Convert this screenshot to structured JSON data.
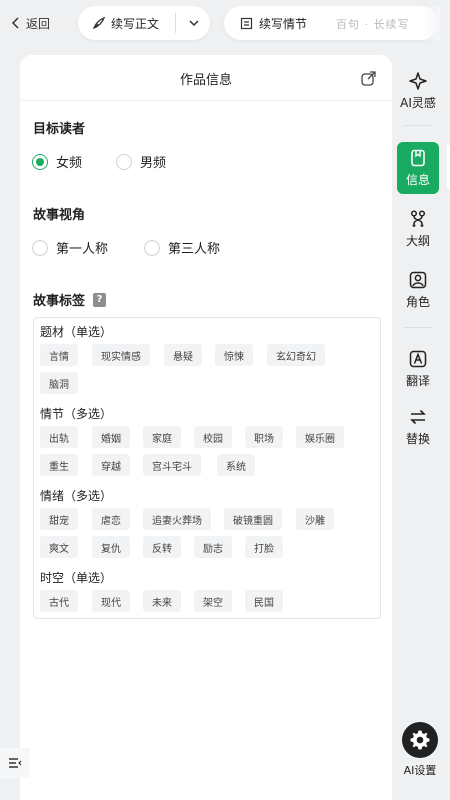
{
  "topbar": {
    "back_label": "返回",
    "continue_label": "续写正文",
    "plot_label": "续写情节",
    "plot_faded": "百句 · 长续写"
  },
  "panel": {
    "title": "作品信息",
    "target_reader": {
      "title": "目标读者",
      "options": [
        "女频",
        "男频"
      ],
      "selected": "女频"
    },
    "perspective": {
      "title": "故事视角",
      "options": [
        "第一人称",
        "第三人称"
      ],
      "selected": ""
    },
    "tags": {
      "title": "故事标签",
      "help_icon": "?",
      "groups": [
        {
          "title": "题材（单选）",
          "items": [
            "言情",
            "现实情感",
            "悬疑",
            "惊悚",
            "玄幻奇幻",
            "脑洞"
          ]
        },
        {
          "title": "情节（多选）",
          "items": [
            "出轨",
            "婚姻",
            "家庭",
            "校园",
            "职场",
            "娱乐圈",
            "重生",
            "穿越",
            "宫斗宅斗",
            "系统"
          ]
        },
        {
          "title": "情绪（多选）",
          "items": [
            "甜宠",
            "虐恋",
            "追妻火葬场",
            "破镜重圆",
            "沙雕",
            "爽文",
            "复仇",
            "反转",
            "励志",
            "打脸"
          ]
        },
        {
          "title": "时空（单选）",
          "items": [
            "古代",
            "现代",
            "未来",
            "架空",
            "民国"
          ]
        }
      ]
    }
  },
  "rail": {
    "items": [
      {
        "label": "AI灵感",
        "icon": "sparkle-icon"
      },
      {
        "label": "信息",
        "icon": "info-doc-icon",
        "active": true
      },
      {
        "label": "大纲",
        "icon": "outline-icon"
      },
      {
        "label": "角色",
        "icon": "person-icon"
      },
      {
        "label": "翻译",
        "icon": "translate-icon"
      },
      {
        "label": "替换",
        "icon": "replace-icon"
      }
    ],
    "settings_label": "AI设置"
  },
  "colors": {
    "accent": "#1aab63",
    "background": "#eef0f2",
    "tag_bg": "#f2f3f5"
  }
}
